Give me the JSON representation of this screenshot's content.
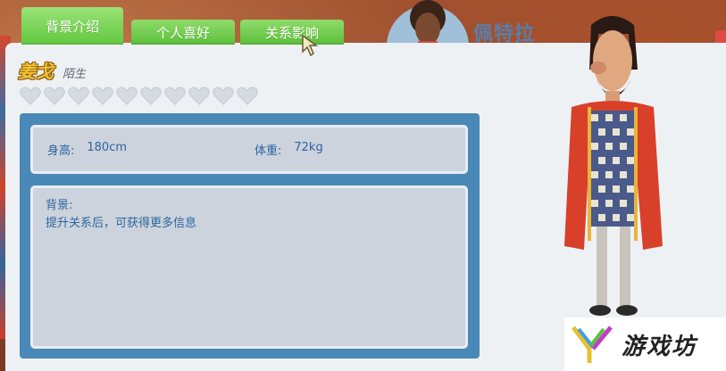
{
  "tabs": [
    {
      "label": "背景介绍",
      "active": true
    },
    {
      "label": "个人喜好",
      "active": false
    },
    {
      "label": "关系影响",
      "active": false
    }
  ],
  "header": {
    "character_name": "佩特拉"
  },
  "character": {
    "name": "姜戈",
    "relation": "陌生",
    "hearts_filled": 0,
    "hearts_total": 10
  },
  "stats": {
    "height_label": "身高:",
    "height_value": "180cm",
    "weight_label": "体重:",
    "weight_value": "72kg"
  },
  "bio": {
    "label": "背景:",
    "text": "提升关系后，可获得更多信息"
  },
  "watermark": {
    "text": "游戏坊"
  },
  "colors": {
    "tab_green": "#6cc84a",
    "panel_bg": "#eef1f4",
    "frame_blue": "#4a88b8",
    "text_blue": "#2e64a0",
    "name_gold": "#f2c233"
  }
}
